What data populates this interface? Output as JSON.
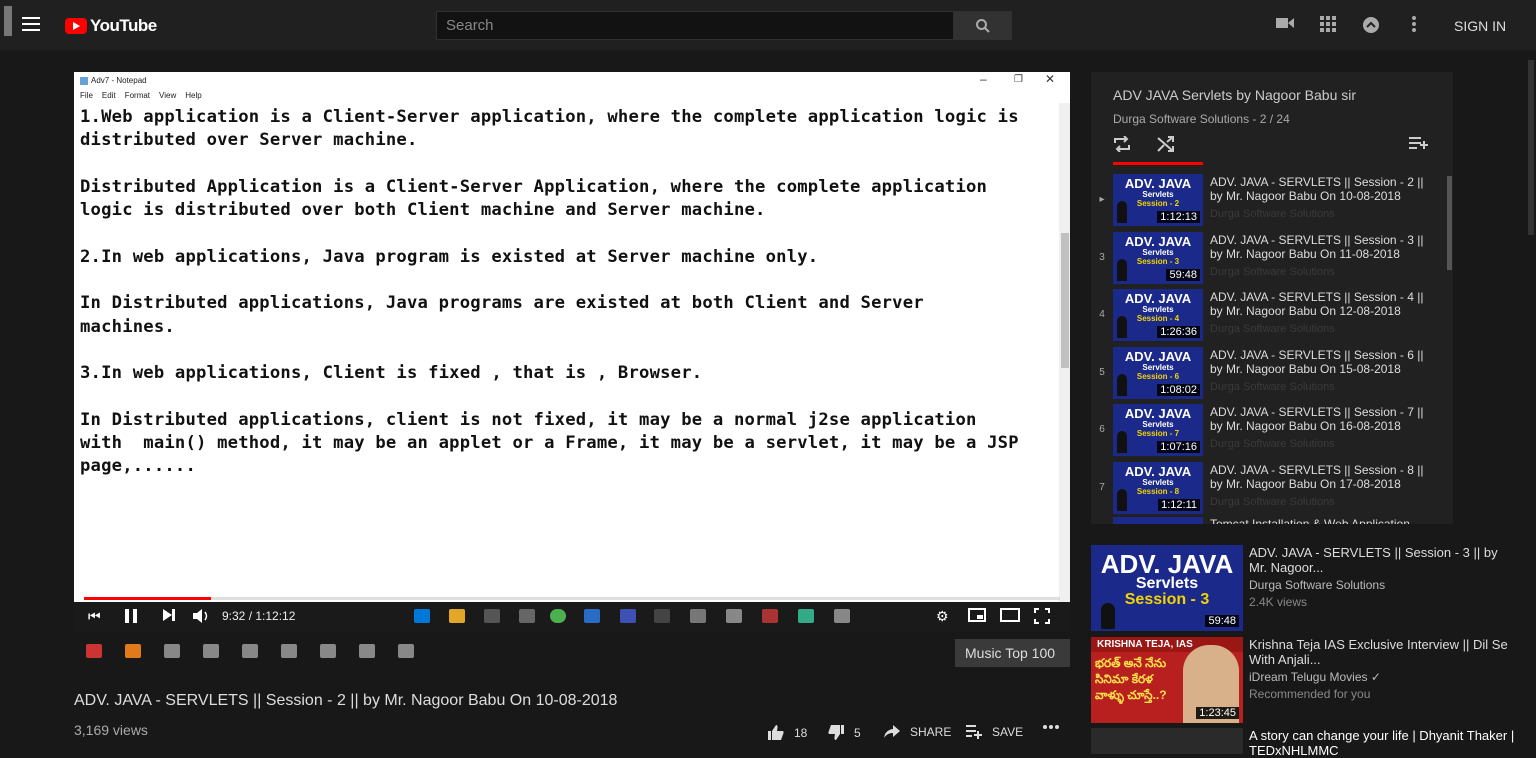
{
  "header": {
    "logo_text": "YouTube",
    "search_placeholder": "Search",
    "sign_in": "SIGN IN"
  },
  "notepad": {
    "title": "Adv7 - Notepad",
    "menu": [
      "File",
      "Edit",
      "Format",
      "View",
      "Help"
    ],
    "text": "1.Web application is a Client-Server application, where the complete application logic is\ndistributed over Server machine.\n\nDistributed Application is a Client-Server Application, where the complete application\nlogic is distributed over both Client machine and Server machine.\n\n2.In web applications, Java program is existed at Server machine only.\n\nIn Distributed applications, Java programs are existed at both Client and Server\nmachines.\n\n3.In web applications, Client is fixed , that is , Browser.\n\nIn Distributed applications, client is not fixed, it may be a normal j2se application\nwith  main() method, it may be an applet or a Frame, it may be a servlet, it may be a JSP\npage,......"
  },
  "player": {
    "time": "9:32 / 1:12:12",
    "progress": 0.13
  },
  "video": {
    "music_chip": "Music Top 100",
    "title": "ADV. JAVA - SERVLETS || Session - 2 || by Mr. Nagoor Babu On 10-08-2018",
    "views": "3,169 views",
    "likes": "18",
    "dislikes": "5",
    "share": "SHARE",
    "save": "SAVE"
  },
  "playlist": {
    "title": "ADV JAVA Servlets by Nagoor Babu sir",
    "channel": "Durga Software Solutions",
    "position": " - 2 / 24",
    "items": [
      {
        "num": "▸",
        "session": "Session - 2",
        "duration": "1:12:13",
        "title": "ADV. JAVA - SERVLETS || Session - 2 || by Mr. Nagoor Babu On 10-08-2018",
        "channel": "Durga Software Solutions"
      },
      {
        "num": "3",
        "session": "Session - 3",
        "duration": "59:48",
        "title": "ADV. JAVA - SERVLETS || Session - 3 || by Mr. Nagoor Babu On 11-08-2018",
        "channel": "Durga Software Solutions"
      },
      {
        "num": "4",
        "session": "Session - 4",
        "duration": "1:26:36",
        "title": "ADV. JAVA - SERVLETS || Session - 4 || by Mr. Nagoor Babu On 12-08-2018",
        "channel": "Durga Software Solutions"
      },
      {
        "num": "5",
        "session": "Session - 6",
        "duration": "1:08:02",
        "title": "ADV. JAVA - SERVLETS || Session - 6 || by Mr. Nagoor Babu On 15-08-2018",
        "channel": "Durga Software Solutions"
      },
      {
        "num": "6",
        "session": "Session - 7",
        "duration": "1:07:16",
        "title": "ADV. JAVA - SERVLETS || Session - 7 || by Mr. Nagoor Babu On 16-08-2018",
        "channel": "Durga Software Solutions"
      },
      {
        "num": "7",
        "session": "Session - 8",
        "duration": "1:12:11",
        "title": "ADV. JAVA - SERVLETS || Session - 8 || by Mr. Nagoor Babu On 17-08-2018",
        "channel": "Durga Software Solutions"
      }
    ],
    "next_partial": "Tomcat Installation & Web Application"
  },
  "thumb_text": {
    "brand": "ADV. JAVA",
    "sub": "Servlets"
  },
  "related": [
    {
      "title": "ADV. JAVA - SERVLETS || Session - 3 || by Mr. Nagoor...",
      "channel": "Durga Software Solutions",
      "meta": "2.4K views",
      "duration": "59:48",
      "thumb_session": "Session - 3"
    },
    {
      "title": "Krishna Teja IAS Exclusive Interview || Dil Se With Anjali...",
      "channel": "iDream Telugu Movies ✓",
      "meta": "Recommended for you",
      "duration": "1:23:45",
      "thumb_caption": "KRISHNA TEJA, IAS",
      "thumb_telugu": "భరత్ అనే నేను సినిమా కేరళ వాళ్ళు చూస్తే..?"
    },
    {
      "title": "A story can change your life | Dhyanit Thaker | TEDxNHLMMC",
      "channel": "",
      "meta": "",
      "duration": ""
    }
  ]
}
